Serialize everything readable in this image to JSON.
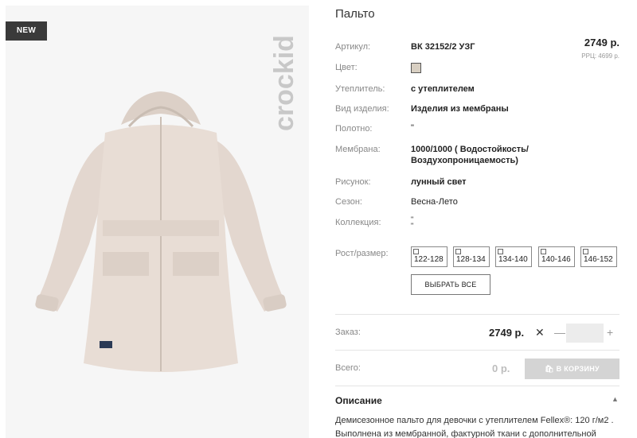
{
  "product": {
    "badge": "NEW",
    "title": "Пальто",
    "brand": "crockid"
  },
  "attributes": [
    {
      "label": "Артикул:",
      "value": "ВК 32152/2 УЗГ"
    },
    {
      "label": "Цвет:",
      "value": ""
    },
    {
      "label": "Утеплитель:",
      "value": "с утеплителем"
    },
    {
      "label": "Вид изделия:",
      "value": "Изделия из мембраны"
    },
    {
      "label": "Полотно:",
      "value": "\""
    },
    {
      "label": "Мембрана:",
      "value": "1000/1000 ( Водостойкость/",
      "value2": "Воздухопроницаемость)"
    },
    {
      "label": "Рисунок:",
      "value": "лунный свет"
    },
    {
      "label": "Сезон:",
      "value": "Весна-Лето"
    },
    {
      "label": "Коллекция:",
      "value": "\"",
      "value2": "\""
    }
  ],
  "colors": {
    "swatch": "#d8cfc2",
    "accent": "#222222"
  },
  "pricing": {
    "price": "2749 р.",
    "rrp": "РРЦ: 4699 р."
  },
  "sizes": {
    "label": "Рост/размер:",
    "options": [
      "122-128",
      "128-134",
      "134-140",
      "140-146",
      "146-152"
    ],
    "select_all": "ВЫБРАТЬ ВСЕ"
  },
  "order": {
    "label": "Заказ:",
    "price": "2749 р.",
    "times": "✕",
    "minus": "—",
    "plus": "+",
    "qty_value": ""
  },
  "total": {
    "label": "Всего:",
    "value": "0 р.",
    "cart_button": "В КОРЗИНУ"
  },
  "description": {
    "title": "Описание",
    "text": "Демисезонное пальто для девочки с утеплителем Fellex®: 120 г/м2 . Выполнена из мембранной, фактурной ткани с дополнительной"
  }
}
